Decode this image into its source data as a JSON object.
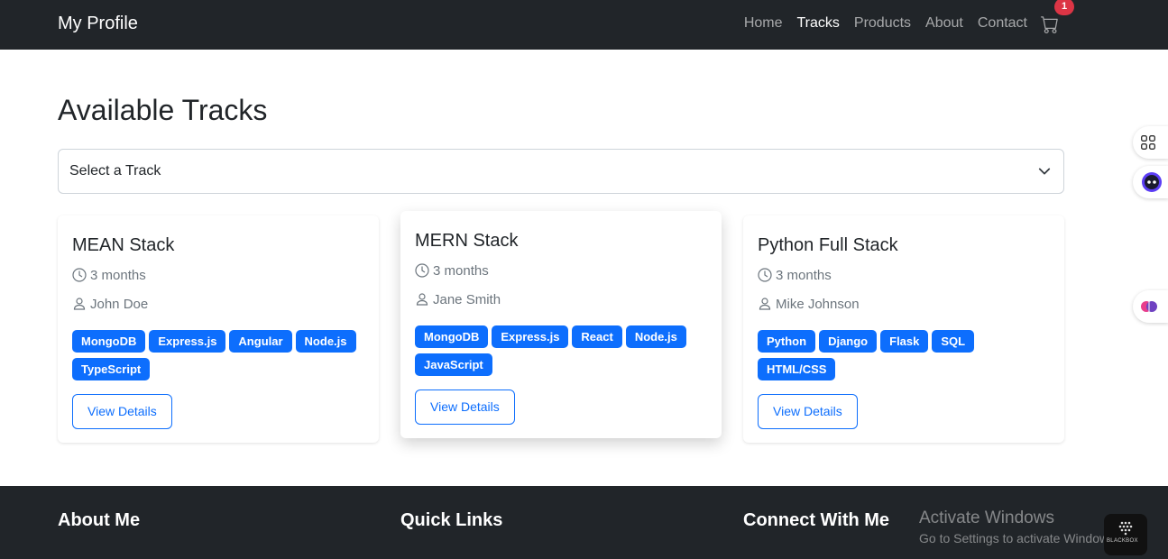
{
  "navbar": {
    "brand": "My Profile",
    "links": [
      {
        "label": "Home",
        "active": false
      },
      {
        "label": "Tracks",
        "active": true
      },
      {
        "label": "Products",
        "active": false
      },
      {
        "label": "About",
        "active": false
      },
      {
        "label": "Contact",
        "active": false
      }
    ],
    "cart_icon": "cart-icon",
    "cart_count": "1"
  },
  "main": {
    "title": "Available Tracks",
    "select": {
      "value": "Select a Track",
      "icon": "chevron-down-icon"
    },
    "cards": [
      {
        "title": "MEAN Stack",
        "duration": "3 months",
        "instructor": "John Doe",
        "tags": [
          "MongoDB",
          "Express.js",
          "Angular",
          "Node.js",
          "TypeScript"
        ],
        "button": "View Details"
      },
      {
        "title": "MERN Stack",
        "duration": "3 months",
        "instructor": "Jane Smith",
        "tags": [
          "MongoDB",
          "Express.js",
          "React",
          "Node.js",
          "JavaScript"
        ],
        "button": "View Details"
      },
      {
        "title": "Python Full Stack",
        "duration": "3 months",
        "instructor": "Mike Johnson",
        "tags": [
          "Python",
          "Django",
          "Flask",
          "SQL",
          "HTML/CSS"
        ],
        "button": "View Details"
      }
    ]
  },
  "footer": {
    "about": "About Me",
    "links": "Quick Links",
    "connect": "Connect With Me"
  },
  "overlay": {
    "activate_title": "Activate Windows",
    "activate_sub": "Go to Settings to activate Windows.",
    "widget_label": "BLACKBOX"
  },
  "colors": {
    "navbar_bg": "#212529",
    "primary": "#0d6efd",
    "badge": "#dc3545"
  }
}
